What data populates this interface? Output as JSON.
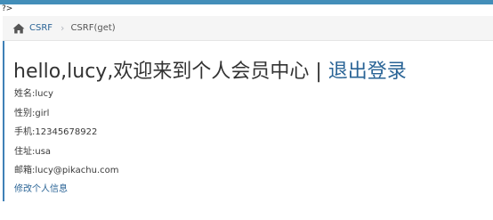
{
  "page": {
    "php_leak": "?>"
  },
  "breadcrumb": {
    "home_icon": "home-icon",
    "parent": "CSRF",
    "separator": "›",
    "current": "CSRF(get)"
  },
  "title": {
    "greeting": "hello,lucy,欢迎来到个人会员中心",
    "divider": "|",
    "logout": "退出登录"
  },
  "profile": {
    "rows": [
      {
        "label": "姓名:",
        "value": "lucy"
      },
      {
        "label": "性别:",
        "value": "girl"
      },
      {
        "label": "手机:",
        "value": "12345678922"
      },
      {
        "label": "住址:",
        "value": "usa"
      },
      {
        "label": "邮箱:",
        "value": "lucy@pikachu.com"
      }
    ],
    "edit_link": "修改个人信息"
  },
  "colors": {
    "accent": "#438eb9",
    "link": "#2a6496",
    "breadcrumb_bg": "#f5f5f5"
  }
}
